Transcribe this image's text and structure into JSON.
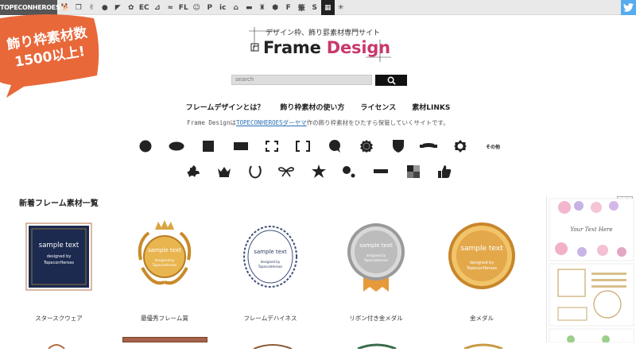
{
  "topbar": {
    "brand": "TOPECONHEROES",
    "icons": [
      {
        "name": "dog-icon",
        "glyph": "🐕"
      },
      {
        "name": "copy-icon",
        "glyph": "❐"
      },
      {
        "name": "stickman-icon",
        "glyph": "✌"
      },
      {
        "name": "speech-bubble-icon",
        "glyph": "●"
      },
      {
        "name": "bird-icon",
        "glyph": "◤"
      },
      {
        "name": "flower-icon",
        "glyph": "✿"
      },
      {
        "name": "ec-icon",
        "glyph": "EC"
      },
      {
        "name": "weight-icon",
        "glyph": "⊿"
      },
      {
        "name": "line-icon",
        "glyph": "≈"
      },
      {
        "name": "flat-icon",
        "glyph": "FL"
      },
      {
        "name": "person-icon",
        "glyph": "☺"
      },
      {
        "name": "parking-icon",
        "glyph": "P"
      },
      {
        "name": "icon-on-icon",
        "glyph": "ic"
      },
      {
        "name": "building-icon",
        "glyph": "⌂"
      },
      {
        "name": "sofa-icon",
        "glyph": "▬"
      },
      {
        "name": "castle-icon",
        "glyph": "♜"
      },
      {
        "name": "hexagon-icon",
        "glyph": "⬢"
      },
      {
        "name": "font-icon",
        "glyph": "F"
      },
      {
        "name": "brush-icon",
        "glyph": "筆"
      },
      {
        "name": "snake-icon",
        "glyph": "S"
      },
      {
        "name": "grid-icon",
        "glyph": "▦"
      },
      {
        "name": "burst-icon",
        "glyph": "✳"
      }
    ],
    "twitter": "twitter-icon"
  },
  "badge": {
    "line1": "飾り枠素材数",
    "line2": "1500以上!",
    "color": "#e8683a"
  },
  "logo": {
    "tagline": "デザイン枠、飾り罫素材専門サイト",
    "main": "Frame ",
    "accent": "Design"
  },
  "search": {
    "placeholder": "search"
  },
  "nav": [
    "フレームデザインとは？",
    "飾り枠素材の使い方",
    "ライセンス",
    "素材LINKS"
  ],
  "desc": {
    "prefix": "Frame Designは",
    "link": "TOPECONHEROESダーヤマ",
    "suffix": "作の飾り枠素材をひたすら保管していくサイトです。"
  },
  "shapes_row1": [
    "circle-shape-icon",
    "ellipse-shape-icon",
    "square-shape-icon",
    "rectangle-shape-icon",
    "corner-bracket-shape-icon",
    "square-bracket-shape-icon",
    "speech-bubble-shape-icon",
    "seal-shape-icon",
    "shield-shape-icon",
    "ribbon-shape-icon",
    "ornament-shape-icon",
    "other-shapes-icon"
  ],
  "other_label": "その他",
  "shapes_row2": [
    "flourish-shape-icon",
    "crown-shape-icon",
    "laurel-shape-icon",
    "bow-shape-icon",
    "star-burst-shape-icon",
    "dots-shape-icon",
    "line-shape-icon",
    "mosaic-shape-icon",
    "thumbs-up-shape-icon"
  ],
  "section": {
    "title": "新着フレーム素材一覧"
  },
  "cards": [
    {
      "caption": "スタースクウェア",
      "sample": "sample text",
      "credit1": "designed by",
      "credit2": "TopeconHeroes"
    },
    {
      "caption": "最優秀フレーム賞",
      "sample": "sample text",
      "credit1": "designed by",
      "credit2": "TopeconHeroes"
    },
    {
      "caption": "フレームデハイネス",
      "sample": "sample text",
      "credit1": "designed by",
      "credit2": "TopeconHeroes"
    },
    {
      "caption": "リボン付き金メダル",
      "sample": "sample text",
      "credit1": "designed by",
      "credit2": "TopeconHeroes"
    },
    {
      "caption": "金メダル",
      "sample": "sample text",
      "credit1": "designed by",
      "credit2": "TopeconHeroes"
    }
  ],
  "ad": {
    "label": "広告",
    "script_text": "Your Text Here"
  },
  "colors": {
    "accent": "#c9386c",
    "badge": "#e8683a",
    "navy": "#1b2a4e",
    "gold": "#d9a441",
    "twitter": "#55acee"
  }
}
